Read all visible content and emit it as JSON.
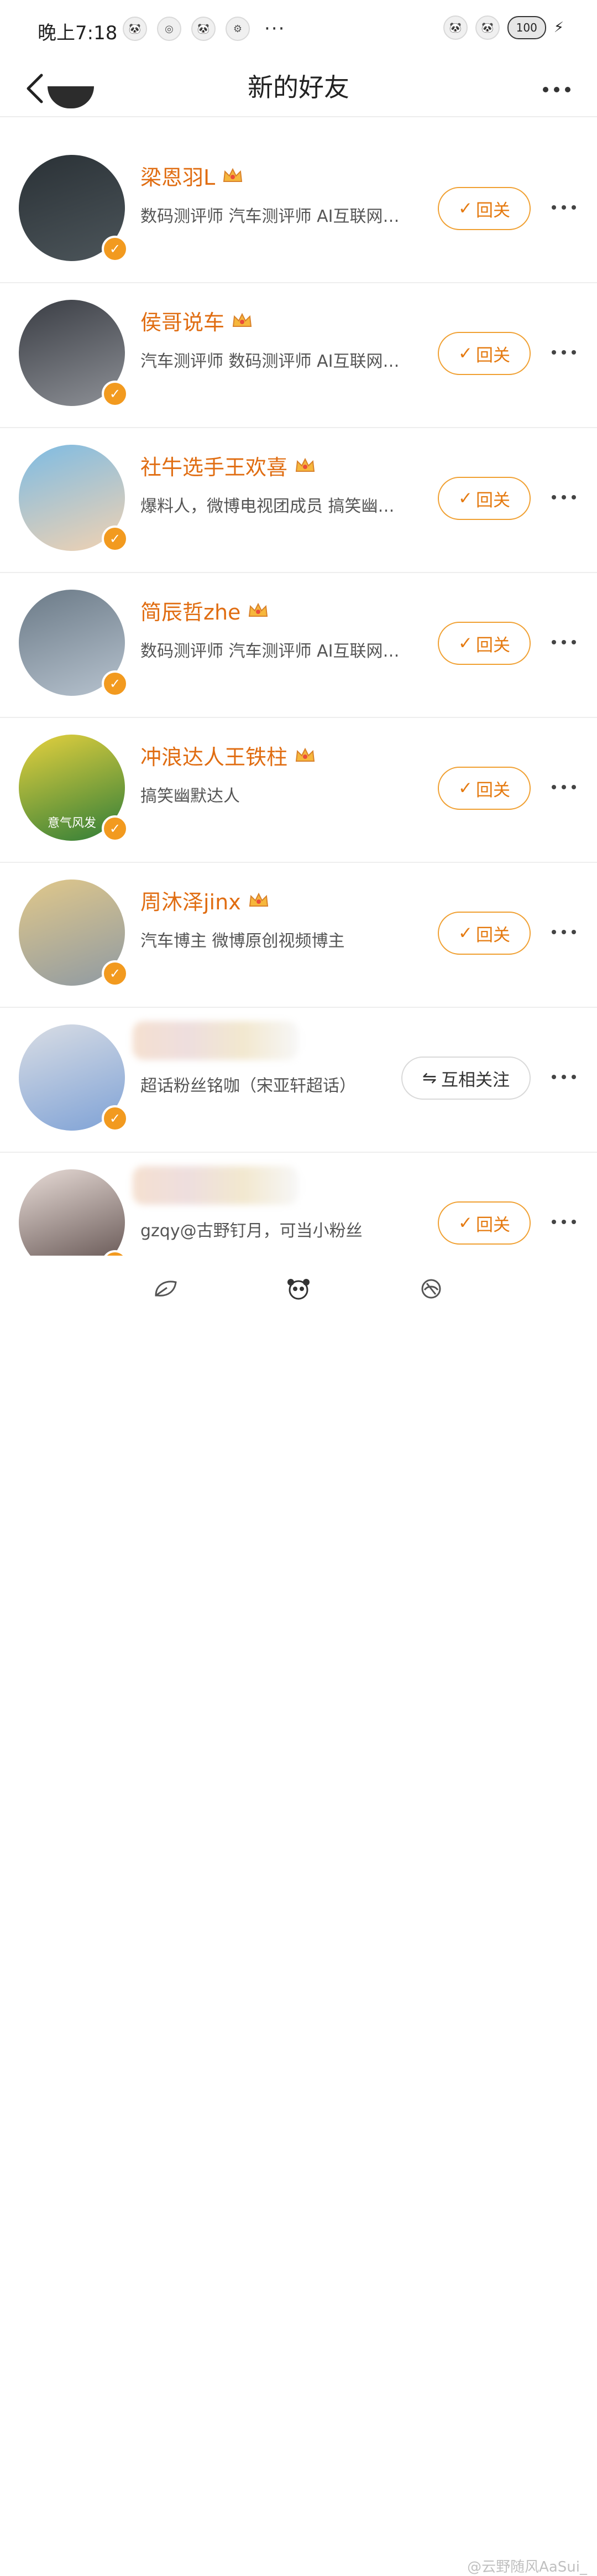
{
  "status_bar": {
    "time": "晚上7:18",
    "icons_left": [
      "npc-panda-icon",
      "swirl-icon",
      "panda-small-icon",
      "gear-icon"
    ],
    "more": "···",
    "battery": "100"
  },
  "nav": {
    "title": "新的好友"
  },
  "friends": [
    {
      "name": "梁恩羽L",
      "desc": "数码测评师 汽车测评师 AI互联网…",
      "action": "回关",
      "avatar_bg": [
        "#2a3136",
        "#4c555a"
      ]
    },
    {
      "name": "侯哥说车",
      "desc": "汽车测评师 数码测评师 AI互联网…",
      "action": "回关",
      "avatar_bg": [
        "#3a3d44",
        "#8d9096"
      ]
    },
    {
      "name": "社牛选手王欢喜",
      "desc": "爆料人，微博电视团成员 搞笑幽…",
      "action": "回关",
      "avatar_bg": [
        "#7dbbe3",
        "#f1d2b2"
      ]
    },
    {
      "name": "简辰哲zhe",
      "desc": "数码测评师 汽车测评师 AI互联网…",
      "action": "回关",
      "avatar_bg": [
        "#6b7a87",
        "#b6c2ce"
      ]
    },
    {
      "name": "冲浪达人王铁柱",
      "desc": "搞笑幽默达人",
      "action": "回关",
      "avatar_bg": [
        "#e6d13e",
        "#2f7d38"
      ],
      "avatar_text": "意气风发"
    },
    {
      "name": "周沐泽jinx",
      "desc": "汽车博主 微博原创视频博主",
      "action": "回关",
      "avatar_bg": [
        "#e1c88a",
        "#8f9aa3"
      ]
    },
    {
      "name": "",
      "desc": "超话粉丝铭咖（宋亚轩超话）",
      "action": "互相关注",
      "avatar_bg": [
        "#d9dde4",
        "#7fa2d6"
      ]
    },
    {
      "name": "",
      "desc": "gzqy@古野钉月，可当小粉丝",
      "action": "回关",
      "avatar_bg": [
        "#e8dcd7",
        "#5a4a48"
      ]
    }
  ],
  "bottom": {
    "tabs": [
      "leaf-icon",
      "panda-icon",
      "sticker-icon"
    ],
    "watermark": "@云野随风AaSui_"
  },
  "colors": {
    "accent": "#e06d12",
    "button_border": "#f0a032",
    "divider": "#eeeeee"
  }
}
